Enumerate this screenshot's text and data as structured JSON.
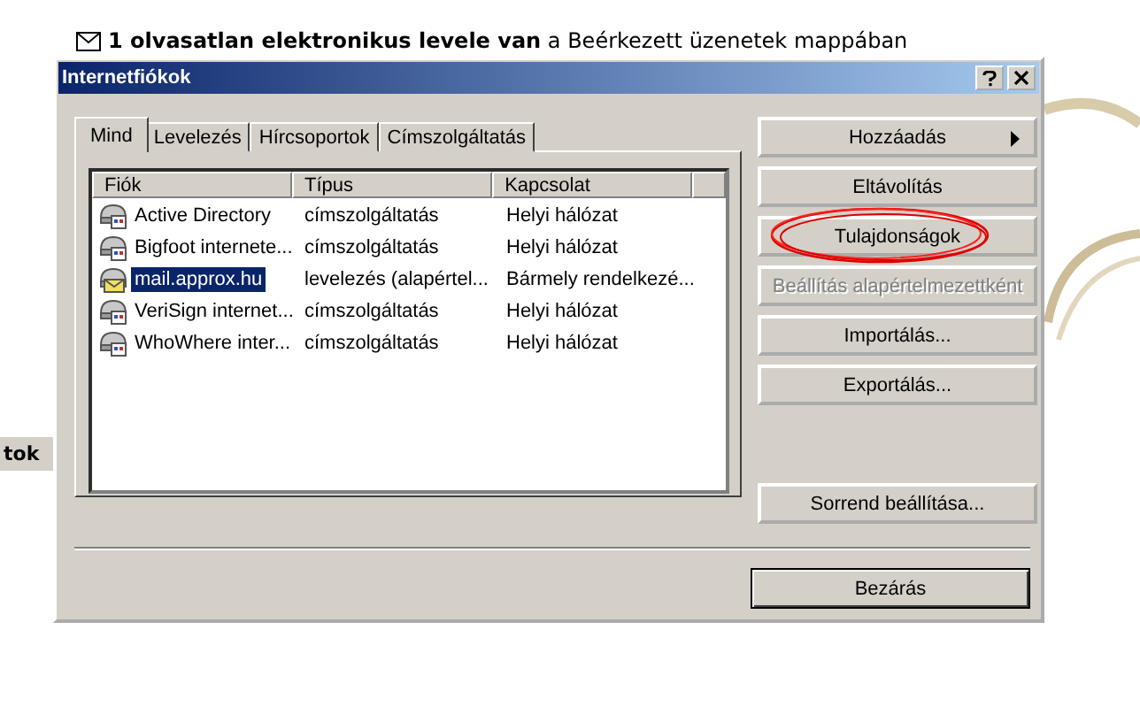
{
  "notification": {
    "bold_text": "1 olvasatlan elektronikus levele van",
    "text": "a Beérkezett üzenetek mappában"
  },
  "side_label": "tok",
  "window": {
    "title": "Internetfiókok"
  },
  "tabs": [
    {
      "label": "Mind",
      "selected": true
    },
    {
      "label": "Levelezés",
      "selected": false
    },
    {
      "label": "Hírcsoportok",
      "selected": false
    },
    {
      "label": "Címszolgáltatás",
      "selected": false
    }
  ],
  "table": {
    "columns": [
      "Fiók",
      "Típus",
      "Kapcsolat"
    ],
    "rows": [
      {
        "kind": "directory",
        "selected": false,
        "cells": [
          "Active Directory",
          "címszolgáltatás",
          "Helyi hálózat"
        ]
      },
      {
        "kind": "directory",
        "selected": false,
        "cells": [
          "Bigfoot internete...",
          "címszolgáltatás",
          "Helyi hálózat"
        ]
      },
      {
        "kind": "mail",
        "selected": true,
        "cells": [
          "mail.approx.hu",
          "levelezés (alapértel...",
          "Bármely rendelkezé..."
        ]
      },
      {
        "kind": "directory",
        "selected": false,
        "cells": [
          "VeriSign internet...",
          "címszolgáltatás",
          "Helyi hálózat"
        ]
      },
      {
        "kind": "directory",
        "selected": false,
        "cells": [
          "WhoWhere inter...",
          "címszolgáltatás",
          "Helyi hálózat"
        ]
      }
    ]
  },
  "buttons": [
    {
      "label": "Hozzáadás",
      "submenu": true,
      "disabled": false,
      "circled": false
    },
    {
      "label": "Eltávolítás",
      "submenu": false,
      "disabled": false,
      "circled": false
    },
    {
      "label": "Tulajdonságok",
      "submenu": false,
      "disabled": false,
      "circled": true
    },
    {
      "label": "Beállítás alapértelmezettként",
      "submenu": false,
      "disabled": true,
      "circled": false
    },
    {
      "label": "Importálás...",
      "submenu": false,
      "disabled": false,
      "circled": false
    },
    {
      "label": "Exportálás...",
      "submenu": false,
      "disabled": false,
      "circled": false
    }
  ],
  "order_button": "Sorrend beállítása...",
  "close_button": "Bezárás"
}
